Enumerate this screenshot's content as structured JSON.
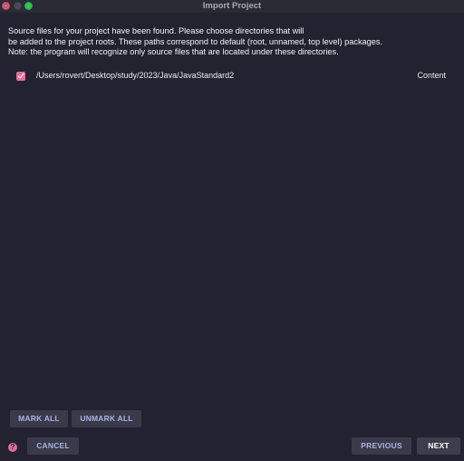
{
  "window": {
    "title": "Import Project"
  },
  "message": {
    "lines": [
      "Source files for your project have been found. Please choose directories that will",
      "be added to the project roots. These paths correspond to default (root, unnamed, top level) packages.",
      "Note: the program will recognize only source files that are located under these directories."
    ]
  },
  "roots": [
    {
      "checked": true,
      "path": "/Users/rovert/Desktop/study/2023/Java/JavaStandard2",
      "type": "Content"
    }
  ],
  "buttons": {
    "mark_all": "MARK ALL",
    "unmark_all": "UNMARK ALL",
    "cancel": "CANCEL",
    "previous": "PREVIOUS",
    "next": "NEXT",
    "help": "?"
  },
  "icons": {
    "close": "close-traffic-light",
    "minimize": "minimize-traffic-light",
    "maximize": "maximize-traffic-light",
    "checkbox": "checkmark-icon",
    "help": "question-mark-icon"
  },
  "colors": {
    "background": "#222230",
    "accent": "#e26f98",
    "secondary_button_text": "#aab4e0",
    "primary_button_text": "#ffffff"
  }
}
